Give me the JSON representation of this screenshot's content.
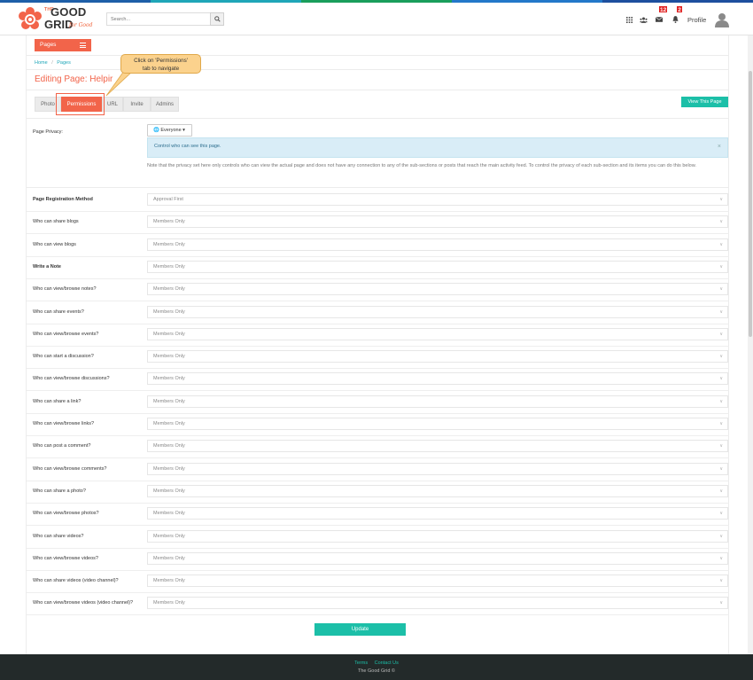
{
  "colors": {
    "accent": "#f2644a",
    "teal": "#1cbfa8",
    "stripe": [
      "#1e5fa8",
      "#1fa6b8",
      "#1a9e5c",
      "#2378c9",
      "#1d4f9e"
    ]
  },
  "brand": {
    "the": "THE",
    "good": "GOOD",
    "grid": "GRID",
    "for": "for Good"
  },
  "header": {
    "search_placeholder": "Search...",
    "apps_icon": "apps-icon",
    "friends_icon": "friends-icon",
    "messages_badge": "12",
    "notifications_badge": "2",
    "profile_label": "Profile"
  },
  "sidebar_button": {
    "label": "Pages"
  },
  "breadcrumb": {
    "home": "Home",
    "separator": "/",
    "current": "Pages"
  },
  "page_title": "Editing Page: Helpir",
  "tabs": [
    {
      "label": "Photo"
    },
    {
      "label": "Permissions"
    },
    {
      "label": "URL"
    },
    {
      "label": "Invite"
    },
    {
      "label": "Admins"
    }
  ],
  "view_page_button": "View This Page",
  "callout": {
    "line1": "Click on 'Permissions'",
    "line2": "tab to navigate"
  },
  "privacy": {
    "label": "Page Privacy:",
    "value": "Everyone",
    "info": "Control who can see this page.",
    "close": "×",
    "note": "Note that the privacy set here only controls who can view the actual page and does not have any connection to any of the sub-sections or posts that reach the main activity feed. To control the privacy of each sub-section and its items you can do this below."
  },
  "rows": [
    {
      "label": "Page Registration Method",
      "value": "Approval First"
    },
    {
      "label": "Who can share blogs",
      "value": "Members Only"
    },
    {
      "label": "Who can view blogs",
      "value": "Members Only"
    },
    {
      "label": "Write a Note",
      "value": "Members Only"
    },
    {
      "label": "Who can view/browse notes?",
      "value": "Members Only"
    },
    {
      "label": "Who can share events?",
      "value": "Members Only"
    },
    {
      "label": "Who can view/browse events?",
      "value": "Members Only"
    },
    {
      "label": "Who can start a discussion?",
      "value": "Members Only"
    },
    {
      "label": "Who can view/browse discussions?",
      "value": "Members Only"
    },
    {
      "label": "Who can share a link?",
      "value": "Members Only"
    },
    {
      "label": "Who can view/browse links?",
      "value": "Members Only"
    },
    {
      "label": "Who can post a comment?",
      "value": "Members Only"
    },
    {
      "label": "Who can view/browse comments?",
      "value": "Members Only"
    },
    {
      "label": "Who can share a photo?",
      "value": "Members Only"
    },
    {
      "label": "Who can view/browse photos?",
      "value": "Members Only"
    },
    {
      "label": "Who can share videos?",
      "value": "Members Only"
    },
    {
      "label": "Who can view/browse videos?",
      "value": "Members Only"
    },
    {
      "label": "Who can share videos (video channel)?",
      "value": "Members Only"
    },
    {
      "label": "Who can view/browse videos (video channel)?",
      "value": "Members Only"
    }
  ],
  "update_button": "Update",
  "footer": {
    "terms": "Terms",
    "contact": "Contact Us",
    "copyright": "The Good Grid ©"
  }
}
